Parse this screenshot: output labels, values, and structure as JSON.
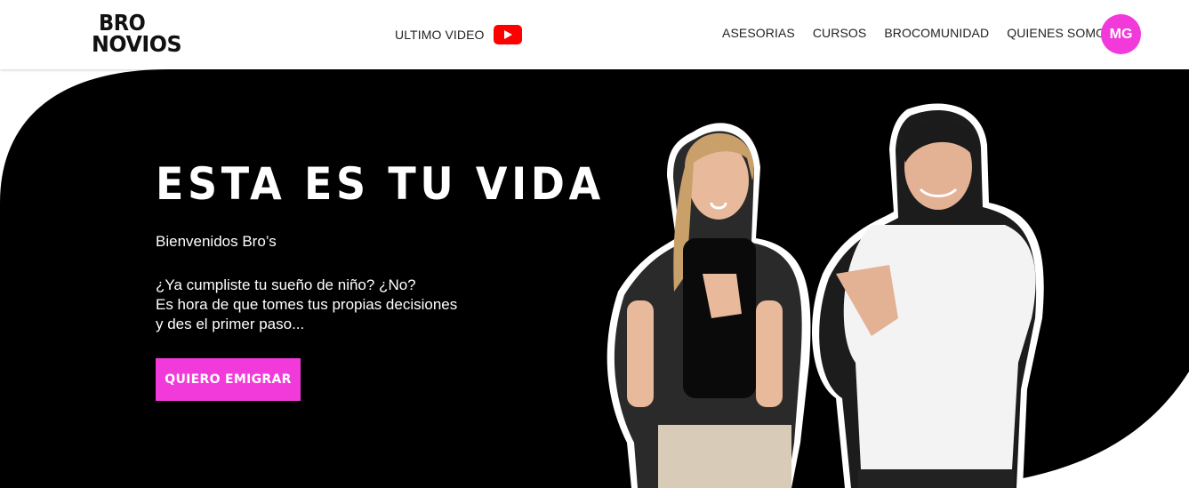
{
  "header": {
    "logo_line1": "BRO",
    "logo_line2": "NOVIOS",
    "video_link": "ULTIMO VIDEO",
    "video_icon": "youtube-icon",
    "nav": [
      "ASESORIAS",
      "CURSOS",
      "BROCOMUNIDAD",
      "QUIENES SOMOS"
    ],
    "avatar_initials": "MG"
  },
  "hero": {
    "title": "ESTA ES TU VIDA",
    "subtitle": "Bienvenidos Bro’s",
    "body": [
      "¿Ya cumpliste tu sueño de niño? ¿No?",
      "Es hora de que tomes tus propias decisiones",
      "y des el primer paso..."
    ],
    "cta_label": "QUIERO EMIGRAR"
  },
  "colors": {
    "accent": "#f13ad9",
    "hero_bg": "#000000",
    "youtube": "#ff0000"
  }
}
